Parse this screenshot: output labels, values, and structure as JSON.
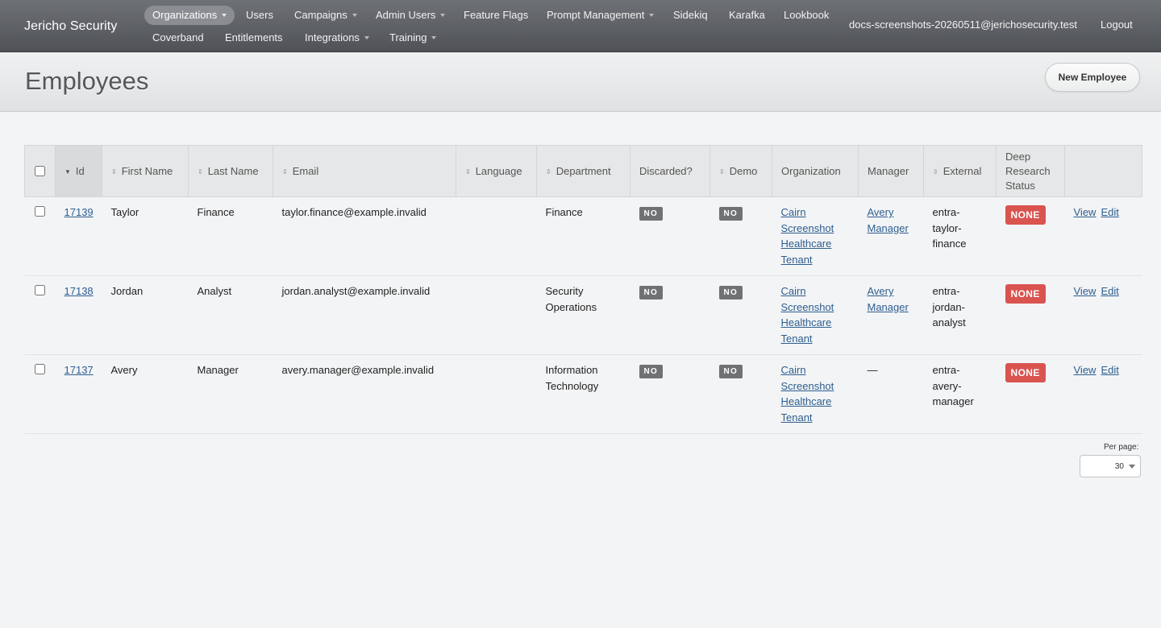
{
  "header": {
    "brand": "Jericho Security",
    "nav_row1": [
      {
        "label": "Organizations",
        "dropdown": true,
        "active": true
      },
      {
        "label": "Users",
        "dropdown": false
      },
      {
        "label": "Campaigns",
        "dropdown": true
      },
      {
        "label": "Admin Users",
        "dropdown": true
      },
      {
        "label": "Feature Flags",
        "dropdown": false
      },
      {
        "label": "Prompt Management",
        "dropdown": true
      },
      {
        "label": "Sidekiq",
        "dropdown": false
      },
      {
        "label": "Karafka",
        "dropdown": false
      },
      {
        "label": "Lookbook",
        "dropdown": false
      }
    ],
    "nav_row2": [
      {
        "label": "Coverband",
        "dropdown": false
      },
      {
        "label": "Entitlements",
        "dropdown": false
      },
      {
        "label": "Integrations",
        "dropdown": true
      },
      {
        "label": "Training",
        "dropdown": true
      }
    ],
    "user_email": "docs-screenshots-20260511@jerichosecurity.test",
    "logout": "Logout"
  },
  "page": {
    "title": "Employees",
    "new_button": "New Employee"
  },
  "table": {
    "columns": {
      "id": "Id",
      "first_name": "First Name",
      "last_name": "Last Name",
      "email": "Email",
      "language": "Language",
      "department": "Department",
      "discarded": "Discarded?",
      "demo": "Demo",
      "organization": "Organization",
      "manager": "Manager",
      "external": "External",
      "deep_research": "Deep Research Status"
    },
    "rows": [
      {
        "id": "17139",
        "first_name": "Taylor",
        "last_name": "Finance",
        "email": "taylor.finance@example.invalid",
        "language": "",
        "department": "Finance",
        "discarded": "NO",
        "demo": "NO",
        "organization": "Cairn Screenshot Healthcare Tenant",
        "manager": "Avery Manager",
        "manager_link": true,
        "external": "entra-taylor-finance",
        "deep_research": "NONE",
        "view": "View",
        "edit": "Edit"
      },
      {
        "id": "17138",
        "first_name": "Jordan",
        "last_name": "Analyst",
        "email": "jordan.analyst@example.invalid",
        "language": "",
        "department": "Security Operations",
        "discarded": "NO",
        "demo": "NO",
        "organization": "Cairn Screenshot Healthcare Tenant",
        "manager": "Avery Manager",
        "manager_link": true,
        "external": "entra-jordan-analyst",
        "deep_research": "NONE",
        "view": "View",
        "edit": "Edit"
      },
      {
        "id": "17137",
        "first_name": "Avery",
        "last_name": "Manager",
        "email": "avery.manager@example.invalid",
        "language": "",
        "department": "Information Technology",
        "discarded": "NO",
        "demo": "NO",
        "organization": "Cairn Screenshot Healthcare Tenant",
        "manager": "—",
        "manager_link": false,
        "external": "entra-avery-manager",
        "deep_research": "NONE",
        "view": "View",
        "edit": "Edit"
      }
    ]
  },
  "pagination": {
    "per_page_label": "Per page:",
    "per_page_value": "30"
  },
  "colors": {
    "header_bg": "#5f6266",
    "link": "#2d5e8f",
    "badge_no": "#6f7275",
    "badge_none": "#d9534f"
  }
}
